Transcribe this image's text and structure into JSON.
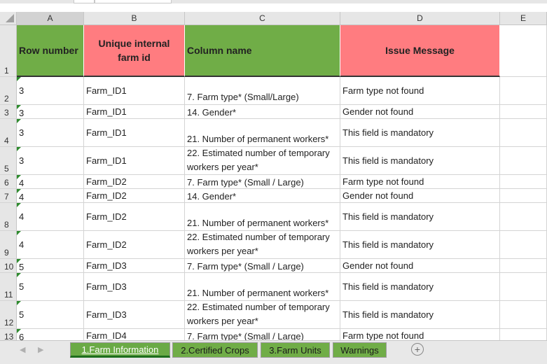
{
  "colors": {
    "header_green": "#70ad47",
    "header_red": "#ff7c80",
    "tab_active": "#6aaa46",
    "tab_green": "#70ad47"
  },
  "columns": [
    "A",
    "B",
    "C",
    "D",
    "E"
  ],
  "header": {
    "row_num": "1",
    "row_number": "Row number",
    "farm_id": "Unique internal farm id",
    "column_name": "Column name",
    "issue_message": "Issue Message"
  },
  "rows": [
    {
      "num": "2",
      "a": "3",
      "b": "Farm_ID1",
      "c": "7. Farm type* (Small/Large)",
      "d": "Farm type not found"
    },
    {
      "num": "3",
      "a": "3",
      "b": "Farm_ID1",
      "c": "14. Gender*",
      "d": "Gender not found"
    },
    {
      "num": "4",
      "a": "3",
      "b": "Farm_ID1",
      "c": "21. Number of permanent workers*",
      "d": "This field is mandatory"
    },
    {
      "num": "5",
      "a": "3",
      "b": "Farm_ID1",
      "c": "22. Estimated number of temporary workers per year*",
      "d": "This field is mandatory"
    },
    {
      "num": "6",
      "a": "4",
      "b": "Farm_ID2",
      "c": "7. Farm type* (Small / Large)",
      "d": "Farm type not found"
    },
    {
      "num": "7",
      "a": "4",
      "b": "Farm_ID2",
      "c": "14. Gender*",
      "d": "Gender not found"
    },
    {
      "num": "8",
      "a": "4",
      "b": "Farm_ID2",
      "c": "21. Number of permanent workers*",
      "d": "This field is mandatory"
    },
    {
      "num": "9",
      "a": "4",
      "b": "Farm_ID2",
      "c": "22. Estimated number of temporary workers per year*",
      "d": "This field is mandatory"
    },
    {
      "num": "10",
      "a": "5",
      "b": "Farm_ID3",
      "c": "7. Farm type* (Small / Large)",
      "d": "Gender not found"
    },
    {
      "num": "11",
      "a": "5",
      "b": "Farm_ID3",
      "c": "21. Number of permanent workers*",
      "d": "This field is mandatory"
    },
    {
      "num": "12",
      "a": "5",
      "b": "Farm_ID3",
      "c": "22. Estimated number of temporary workers per year*",
      "d": "This field is mandatory"
    },
    {
      "num": "13",
      "a": "6",
      "b": "Farm_ID4",
      "c": "7. Farm type* (Small / Large)",
      "d": "Farm type not found"
    }
  ],
  "sheet_tabs": [
    {
      "label": "1.Farm Information",
      "active": true
    },
    {
      "label": "2.Certified Crops",
      "active": false
    },
    {
      "label": "3.Farm Units",
      "active": false
    },
    {
      "label": "Warnings",
      "active": false
    }
  ],
  "nav": {
    "prev": "◀",
    "next": "▶",
    "add": "+"
  }
}
